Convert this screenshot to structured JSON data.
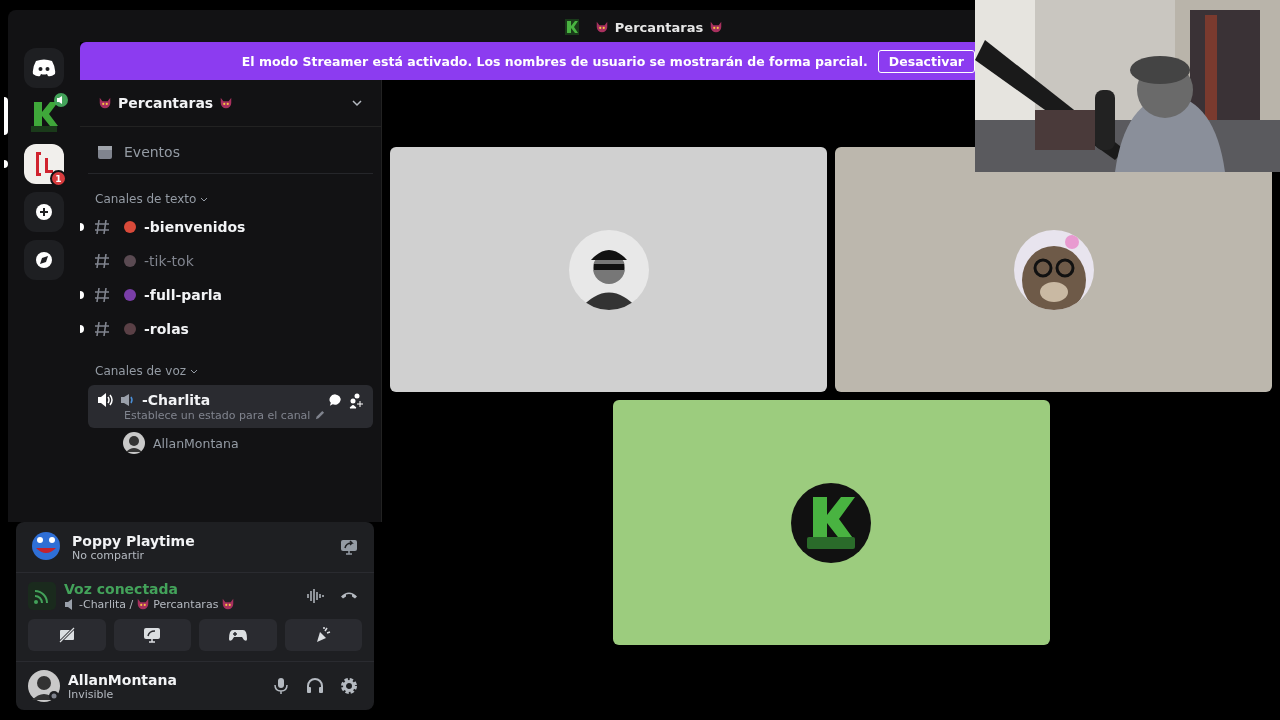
{
  "window": {
    "title": "Percantaras"
  },
  "banner": {
    "text": "El modo Streamer está activado. Los nombres de usuario se mostrarán de forma parcial.",
    "button": "Desactivar"
  },
  "servers": [
    {
      "kind": "home",
      "selected": false,
      "unread": false
    },
    {
      "kind": "kluny",
      "selected": true,
      "speaking": true
    },
    {
      "kind": "red",
      "selected": false,
      "unread": true,
      "badge": "1"
    },
    {
      "kind": "add",
      "selected": false,
      "unread": false
    },
    {
      "kind": "explore",
      "selected": false,
      "unread": false
    }
  ],
  "sidebar": {
    "server_name": "Percantaras",
    "events": "Eventos",
    "text_category": "Canales de texto",
    "text_channels": [
      {
        "name": "-bienvenidos",
        "unread": true,
        "color": "#d94a3a"
      },
      {
        "name": "-tik-tok",
        "unread": false,
        "color": "#5a4a52"
      },
      {
        "name": "-full-parla",
        "unread": true,
        "color": "#7a3ea8"
      },
      {
        "name": "-rolas",
        "unread": true,
        "color": "#5a4046"
      }
    ],
    "voice_category": "Canales de voz",
    "voice_channels": [
      {
        "name": "-Charlita",
        "status": "Establece un estado para el canal",
        "selected": true,
        "members": [
          "AllanMontana"
        ]
      }
    ]
  },
  "panel": {
    "activity": {
      "title": "Poppy Playtime",
      "subtitle": "No compartir"
    },
    "voice": {
      "status": "Voz conectada",
      "channel": "-Charlita /",
      "server": "Percantaras"
    },
    "user": {
      "name": "AllanMontana",
      "status": "Invisible"
    }
  },
  "tiles": [
    {
      "color": "#d0d0d0",
      "kind": "person"
    },
    {
      "color": "#bcb7ad",
      "kind": "otter"
    },
    {
      "color": "#9ccc7e",
      "kind": "kluny"
    }
  ]
}
